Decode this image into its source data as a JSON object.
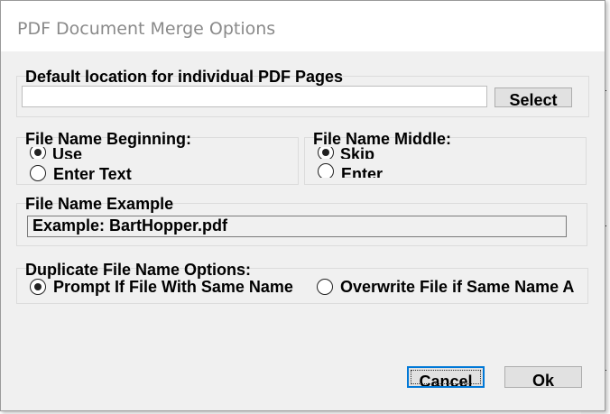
{
  "dialog": {
    "title": "PDF Document Merge Options"
  },
  "default_location": {
    "label": "Default location for individual PDF Pages",
    "path_value": "",
    "select_label": "Select"
  },
  "file_name_beginning": {
    "label": "File Name Beginning:",
    "options": [
      {
        "label": "Use",
        "checked": true
      },
      {
        "label": "Enter Text",
        "checked": false
      }
    ]
  },
  "file_name_middle": {
    "label": "File Name Middle:",
    "options": [
      {
        "label": "Skip",
        "checked": true
      },
      {
        "label": "Enter",
        "checked": false
      }
    ]
  },
  "file_name_example": {
    "label": "File Name Example",
    "value": "Example: BartHopper.pdf"
  },
  "duplicate_options": {
    "label": "Duplicate File Name Options:",
    "options": [
      {
        "label": "Prompt If File With Same Name",
        "checked": true
      },
      {
        "label": "Overwrite File if Same Name A",
        "checked": false
      }
    ]
  },
  "buttons": {
    "cancel_label": "Cancel",
    "ok_label": "Ok"
  }
}
